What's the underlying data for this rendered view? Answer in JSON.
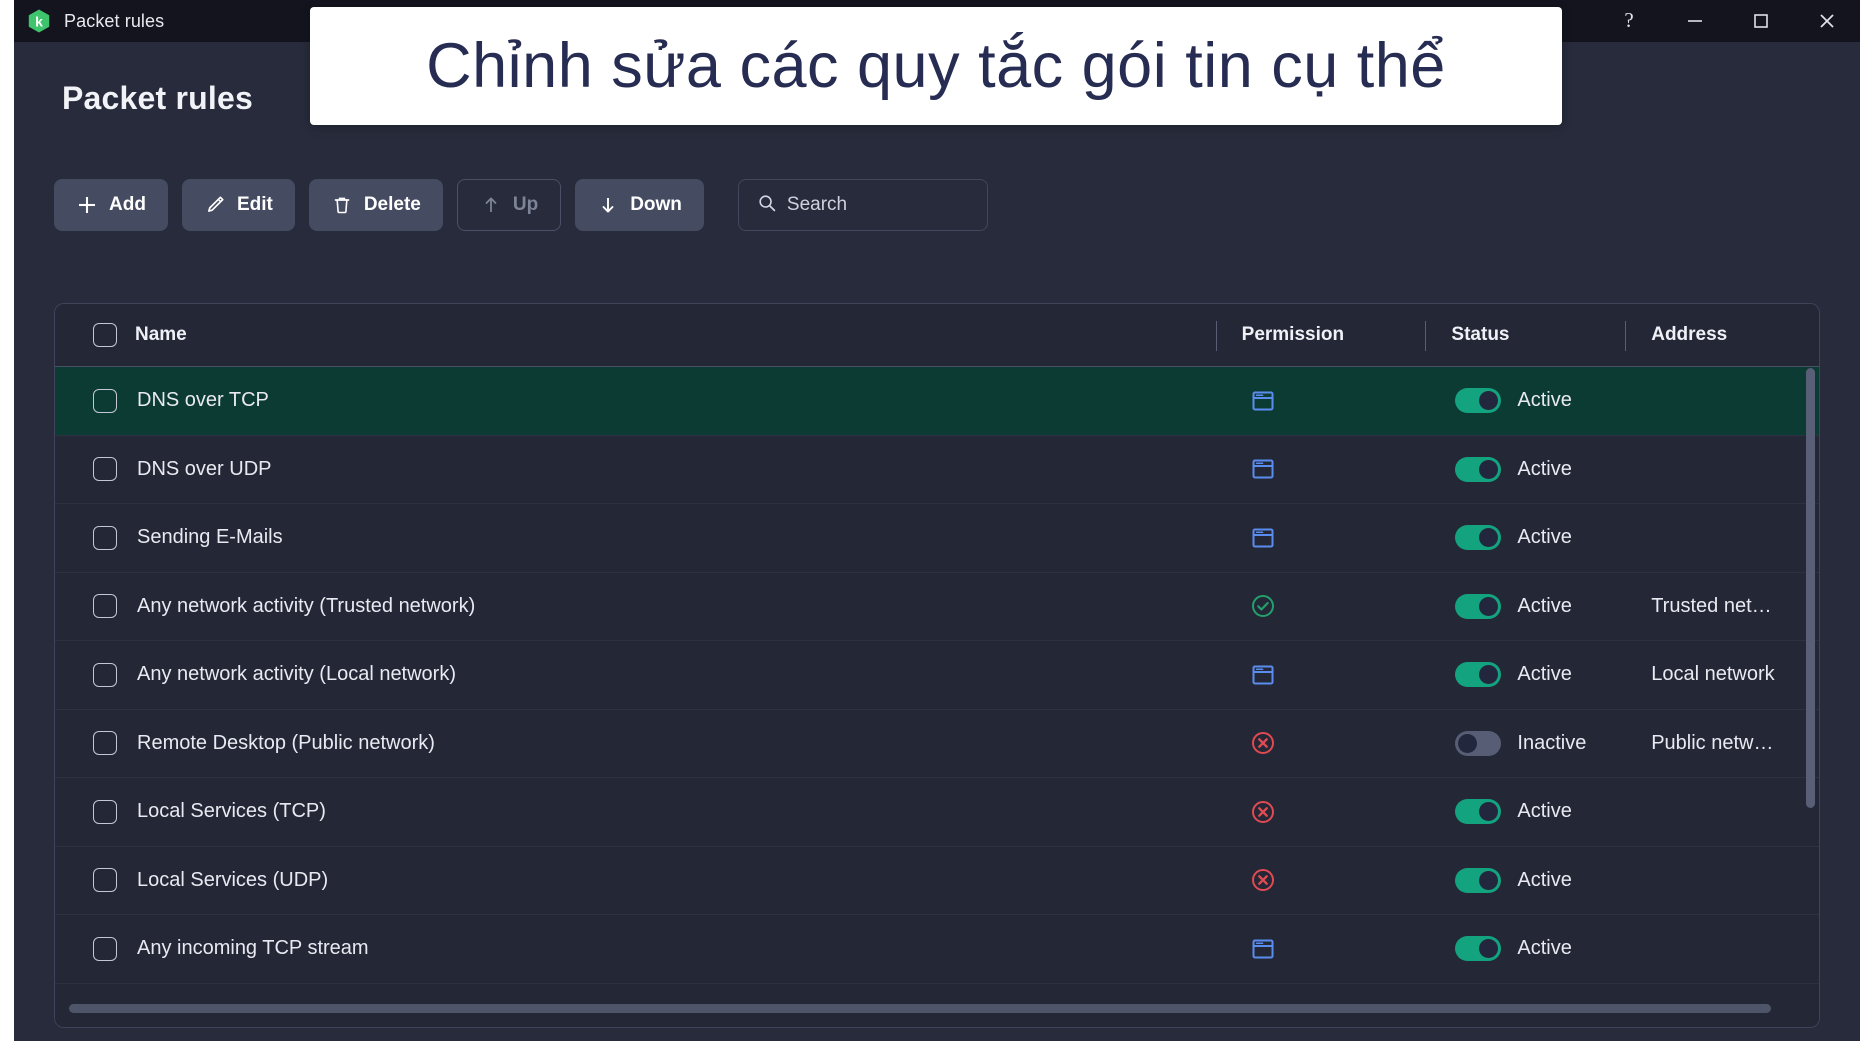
{
  "window": {
    "titlebar_title": "Packet rules",
    "logo_icon": "kaspersky-hexagon-logo",
    "controls": [
      {
        "name": "help-button",
        "icon": "question-mark-icon",
        "glyph": "?"
      },
      {
        "name": "minimize-button",
        "icon": "minimize-icon",
        "glyph": "–"
      },
      {
        "name": "maximize-button",
        "icon": "maximize-icon",
        "glyph": "□"
      },
      {
        "name": "close-button",
        "icon": "close-icon",
        "glyph": "✕"
      }
    ]
  },
  "page": {
    "title": "Packet rules"
  },
  "toolbar": {
    "add_label": "Add",
    "edit_label": "Edit",
    "delete_label": "Delete",
    "up_label": "Up",
    "down_label": "Down",
    "icons": {
      "add": "plus-icon",
      "edit": "pencil-icon",
      "delete": "trash-icon",
      "up": "arrow-up-icon",
      "down": "arrow-down-icon",
      "search": "search-icon"
    }
  },
  "search": {
    "placeholder": "Search",
    "value": ""
  },
  "table": {
    "columns": [
      {
        "key": "name",
        "label": "Name"
      },
      {
        "key": "permission",
        "label": "Permission"
      },
      {
        "key": "status",
        "label": "Status"
      },
      {
        "key": "address",
        "label": "Address"
      }
    ],
    "rows": [
      {
        "name": "DNS over TCP",
        "permission": "ask",
        "permission_icon": "window-prompt-icon",
        "status": "Active",
        "status_on": true,
        "address": "",
        "selected": true
      },
      {
        "name": "DNS over UDP",
        "permission": "ask",
        "permission_icon": "window-prompt-icon",
        "status": "Active",
        "status_on": true,
        "address": "",
        "selected": false
      },
      {
        "name": "Sending E-Mails",
        "permission": "ask",
        "permission_icon": "window-prompt-icon",
        "status": "Active",
        "status_on": true,
        "address": "",
        "selected": false
      },
      {
        "name": "Any network activity (Trusted network)",
        "permission": "allow",
        "permission_icon": "check-circle-icon",
        "status": "Active",
        "status_on": true,
        "address": "Trusted net…",
        "selected": false
      },
      {
        "name": "Any network activity (Local network)",
        "permission": "ask",
        "permission_icon": "window-prompt-icon",
        "status": "Active",
        "status_on": true,
        "address": "Local network",
        "selected": false
      },
      {
        "name": "Remote Desktop (Public network)",
        "permission": "block",
        "permission_icon": "block-circle-icon",
        "status": "Inactive",
        "status_on": false,
        "address": "Public netw…",
        "selected": false
      },
      {
        "name": "Local Services (TCP)",
        "permission": "block",
        "permission_icon": "block-circle-icon",
        "status": "Active",
        "status_on": true,
        "address": "",
        "selected": false
      },
      {
        "name": "Local Services (UDP)",
        "permission": "block",
        "permission_icon": "block-circle-icon",
        "status": "Active",
        "status_on": true,
        "address": "",
        "selected": false
      },
      {
        "name": "Any incoming TCP stream",
        "permission": "ask",
        "permission_icon": "window-prompt-icon",
        "status": "Active",
        "status_on": true,
        "address": "",
        "selected": false
      }
    ]
  },
  "tooltip": {
    "text": "Chỉnh sửa các quy tắc gói tin cụ thể"
  },
  "colors": {
    "window_bg": "#272b3b",
    "titlebar_bg": "#14141f",
    "panel_bg": "#232736",
    "selected_row": "#0c3b33",
    "accent_green": "#13a37f",
    "permission_ask_blue": "#5b8def",
    "permission_allow_green": "#23a06c",
    "permission_block_red": "#e04a52",
    "button_bg": "#454b60",
    "tooltip_text": "#262c52",
    "tooltip_bg": "#ffffff"
  }
}
